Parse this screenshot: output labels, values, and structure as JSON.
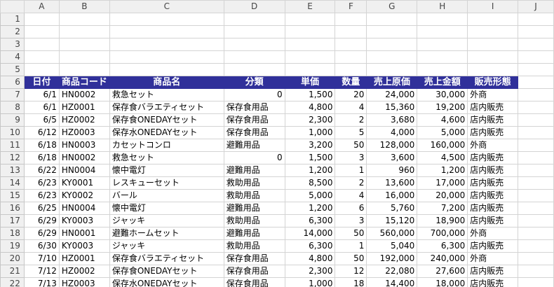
{
  "columns": [
    "A",
    "B",
    "C",
    "D",
    "E",
    "F",
    "G",
    "H",
    "I",
    "J"
  ],
  "row_numbers": [
    "1",
    "2",
    "3",
    "4",
    "5",
    "6",
    "7",
    "8",
    "9",
    "10",
    "11",
    "12",
    "13",
    "14",
    "15",
    "16",
    "17",
    "18",
    "19",
    "20",
    "21",
    "22"
  ],
  "headers": [
    "日付",
    "商品コード",
    "商品名",
    "分類",
    "単価",
    "数量",
    "売上原価",
    "売上金額",
    "販売形態"
  ],
  "rows": [
    [
      "6/1",
      "HN0002",
      "救急セット",
      "0",
      "1,500",
      "20",
      "24,000",
      "30,000",
      "外商"
    ],
    [
      "6/1",
      "HZ0001",
      "保存食バラエティセット",
      "保存食用品",
      "4,800",
      "4",
      "15,360",
      "19,200",
      "店内販売"
    ],
    [
      "6/5",
      "HZ0002",
      "保存食ONEDAYセット",
      "保存食用品",
      "2,300",
      "2",
      "3,680",
      "4,600",
      "店内販売"
    ],
    [
      "6/12",
      "HZ0003",
      "保存水ONEDAYセット",
      "保存食用品",
      "1,000",
      "5",
      "4,000",
      "5,000",
      "店内販売"
    ],
    [
      "6/18",
      "HN0003",
      "カセットコンロ",
      "避難用品",
      "3,200",
      "50",
      "128,000",
      "160,000",
      "外商"
    ],
    [
      "6/18",
      "HN0002",
      "救急セット",
      "0",
      "1,500",
      "3",
      "3,600",
      "4,500",
      "店内販売"
    ],
    [
      "6/22",
      "HN0004",
      "懐中電灯",
      "避難用品",
      "1,200",
      "1",
      "960",
      "1,200",
      "店内販売"
    ],
    [
      "6/23",
      "KY0001",
      "レスキューセット",
      "救助用品",
      "8,500",
      "2",
      "13,600",
      "17,000",
      "店内販売"
    ],
    [
      "6/23",
      "KY0002",
      "バール",
      "救助用品",
      "5,000",
      "4",
      "16,000",
      "20,000",
      "店内販売"
    ],
    [
      "6/25",
      "HN0004",
      "懐中電灯",
      "避難用品",
      "1,200",
      "6",
      "5,760",
      "7,200",
      "店内販売"
    ],
    [
      "6/29",
      "KY0003",
      "ジャッキ",
      "救助用品",
      "6,300",
      "3",
      "15,120",
      "18,900",
      "店内販売"
    ],
    [
      "6/29",
      "HN0001",
      "避難ホームセット",
      "避難用品",
      "14,000",
      "50",
      "560,000",
      "700,000",
      "外商"
    ],
    [
      "6/30",
      "KY0003",
      "ジャッキ",
      "救助用品",
      "6,300",
      "1",
      "5,040",
      "6,300",
      "店内販売"
    ],
    [
      "7/10",
      "HZ0001",
      "保存食バラエティセット",
      "保存食用品",
      "4,800",
      "50",
      "192,000",
      "240,000",
      "外商"
    ],
    [
      "7/12",
      "HZ0002",
      "保存食ONEDAYセット",
      "保存食用品",
      "2,300",
      "12",
      "22,080",
      "27,600",
      "店内販売"
    ],
    [
      "7/13",
      "HZ0003",
      "保存水ONEDAYセット",
      "保存食用品",
      "1,000",
      "18",
      "14,400",
      "18,000",
      "店内販売"
    ]
  ]
}
